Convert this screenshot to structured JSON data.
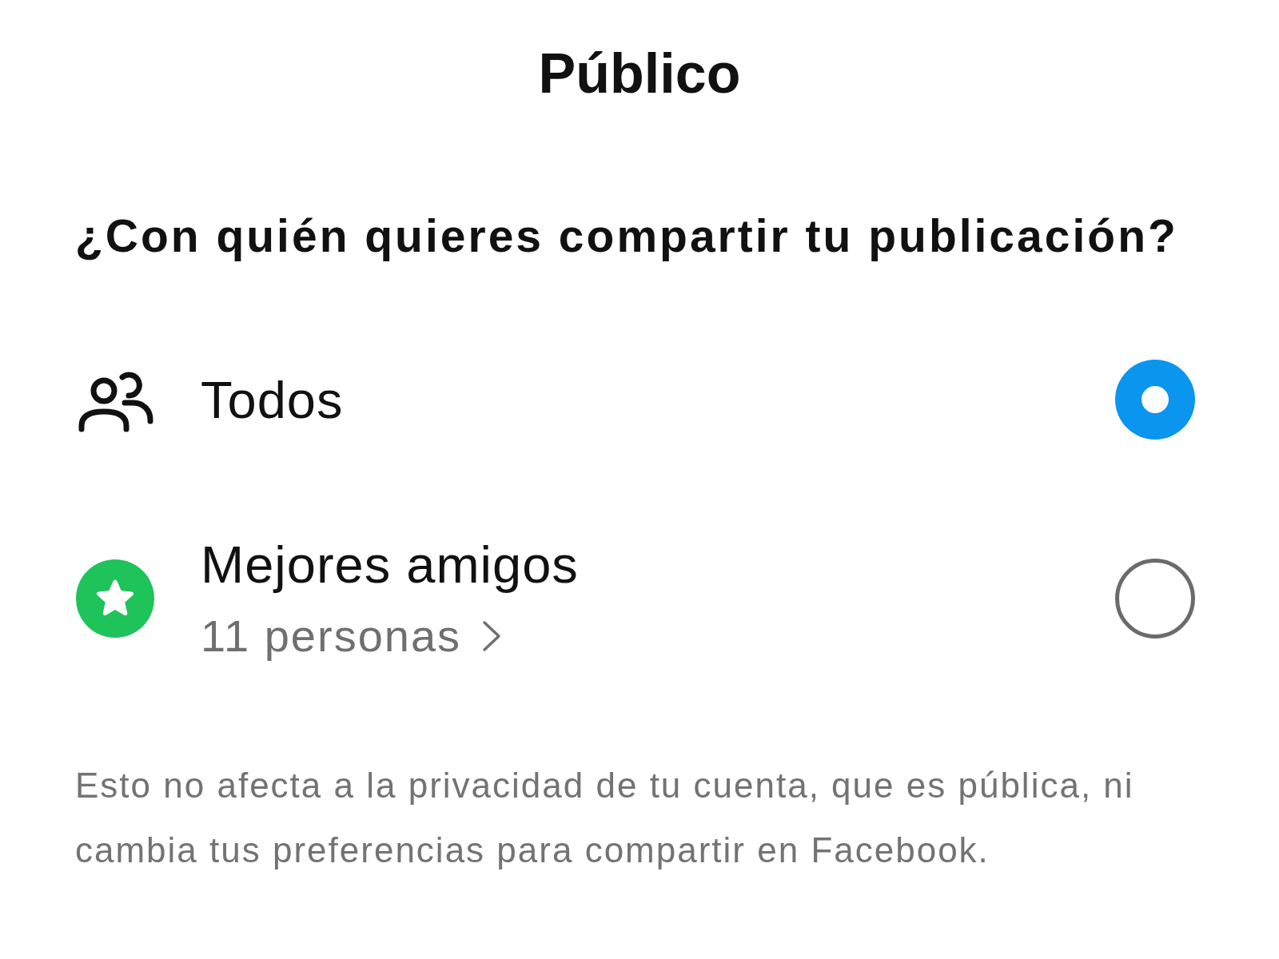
{
  "header": {
    "title": "Público"
  },
  "question": "¿Con quién quieres compartir tu publicación?",
  "options": [
    {
      "kind": "everyone",
      "label": "Todos",
      "selected": true
    },
    {
      "kind": "close_friends",
      "label": "Mejores amigos",
      "count": "11 personas",
      "selected": false
    }
  ],
  "note": "Esto no afecta a la privacidad de tu cuenta, que es pública, ni cambia tus preferencias para compartir en Facebook."
}
